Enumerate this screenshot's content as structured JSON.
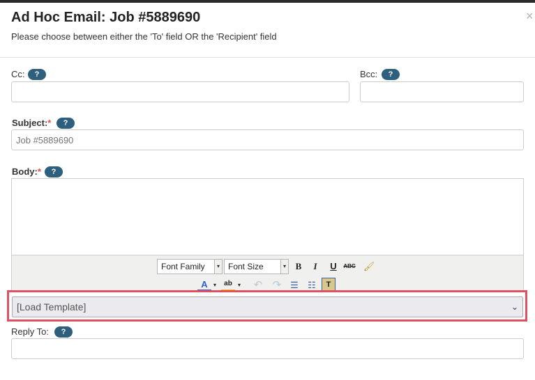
{
  "dialog": {
    "title": "Ad Hoc Email: Job #5889690",
    "subtitle": "Please choose between either the 'To' field OR the 'Recipient' field",
    "close_glyph": "×"
  },
  "help_glyph": "?",
  "required_marker": "*",
  "fields": {
    "cc": {
      "label": "Cc:",
      "value": ""
    },
    "bcc": {
      "label": "Bcc:",
      "value": ""
    },
    "subject": {
      "label": "Subject:",
      "placeholder": "Job #5889690"
    },
    "body": {
      "label": "Body:"
    },
    "reply_to": {
      "label": "Reply To:",
      "value": ""
    }
  },
  "toolbar": {
    "font_family": "Font Family",
    "font_size": "Font Size",
    "buttons": {
      "bold": "B",
      "italic": "I",
      "underline": "U",
      "strikethrough": "ABC",
      "clear_format": "🖌",
      "font_color": "A",
      "highlight": "ab",
      "undo": "↶",
      "redo": "↷",
      "bullet_list": "☰",
      "numbered_list": "☷",
      "paste_text": "T"
    },
    "dropdown_caret": "▾"
  },
  "template": {
    "selected": "[Load Template]",
    "chevron": "⌄"
  },
  "colors": {
    "help_badge": "#2e5f7e",
    "required": "#d9534f",
    "highlight_border": "#e05060",
    "toolbar_bg": "#f0f0ee",
    "font_color_underline": "#2b5fd0",
    "highlight_underline": "#f0c000"
  },
  "icons": [
    "close-icon",
    "help-icon",
    "bold-icon",
    "italic-icon",
    "underline-icon",
    "strikethrough-icon",
    "clear-format-icon",
    "font-color-icon",
    "highlight-icon",
    "undo-icon",
    "redo-icon",
    "bullet-list-icon",
    "numbered-list-icon",
    "paste-text-icon",
    "chevron-down-icon"
  ]
}
